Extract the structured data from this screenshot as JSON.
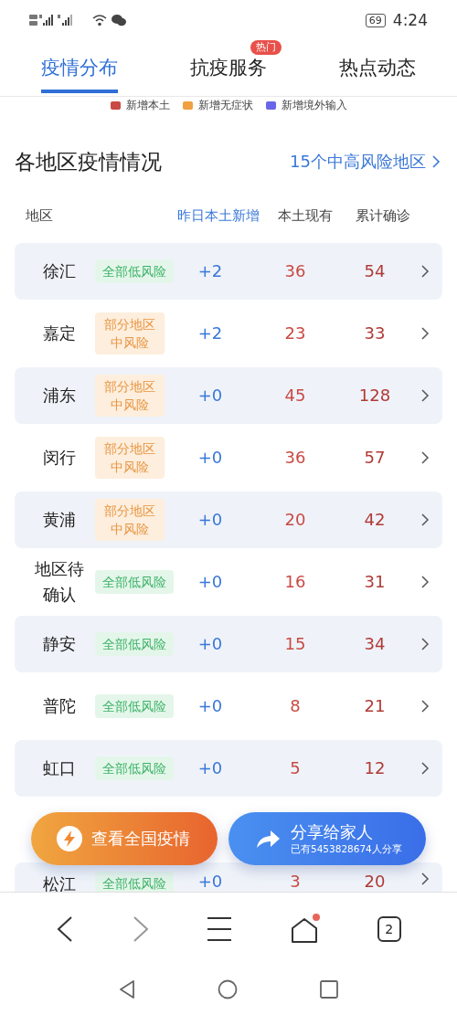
{
  "status_bar": {
    "battery": "69",
    "time": "4:24"
  },
  "tabs": [
    {
      "label": "疫情分布",
      "selected": true
    },
    {
      "label": "抗疫服务",
      "selected": false,
      "badge": "热门"
    },
    {
      "label": "热点动态",
      "selected": false
    }
  ],
  "legend": [
    {
      "label": "新增本土",
      "color": "#c94a44"
    },
    {
      "label": "新增无症状",
      "color": "#f0a040"
    },
    {
      "label": "新增境外输入",
      "color": "#6a66e8"
    }
  ],
  "section": {
    "title": "各地区疫情情况",
    "link": "15个中高风险地区"
  },
  "table": {
    "columns": [
      "地区",
      "昨日本土新增",
      "本土现有",
      "累计确诊"
    ],
    "rows": [
      {
        "region": "徐汇",
        "risk": "全部低风险",
        "kind": "low",
        "new": "+2",
        "current": "36",
        "total": "54"
      },
      {
        "region": "嘉定",
        "risk": "部分地区中风险",
        "kind": "mid",
        "new": "+2",
        "current": "23",
        "total": "33"
      },
      {
        "region": "浦东",
        "risk": "部分地区中风险",
        "kind": "mid",
        "new": "+0",
        "current": "45",
        "total": "128"
      },
      {
        "region": "闵行",
        "risk": "部分地区中风险",
        "kind": "mid",
        "new": "+0",
        "current": "36",
        "total": "57"
      },
      {
        "region": "黄浦",
        "risk": "部分地区中风险",
        "kind": "mid",
        "new": "+0",
        "current": "20",
        "total": "42"
      },
      {
        "region": "地区待确认",
        "risk": "全部低风险",
        "kind": "low",
        "new": "+0",
        "current": "16",
        "total": "31"
      },
      {
        "region": "静安",
        "risk": "全部低风险",
        "kind": "low",
        "new": "+0",
        "current": "15",
        "total": "34"
      },
      {
        "region": "普陀",
        "risk": "全部低风险",
        "kind": "low",
        "new": "+0",
        "current": "8",
        "total": "21"
      },
      {
        "region": "虹口",
        "risk": "全部低风险",
        "kind": "low",
        "new": "+0",
        "current": "5",
        "total": "12"
      },
      {
        "region": "松江",
        "risk": "全部低风险",
        "kind": "low",
        "new": "+0",
        "current": "3",
        "total": "20"
      }
    ]
  },
  "actions": {
    "national": "查看全国疫情",
    "share": "分享给家人",
    "share_count": "已有5453828674人分享"
  },
  "browser_bar": {
    "tabs_count": "2",
    "home_dot": true
  }
}
